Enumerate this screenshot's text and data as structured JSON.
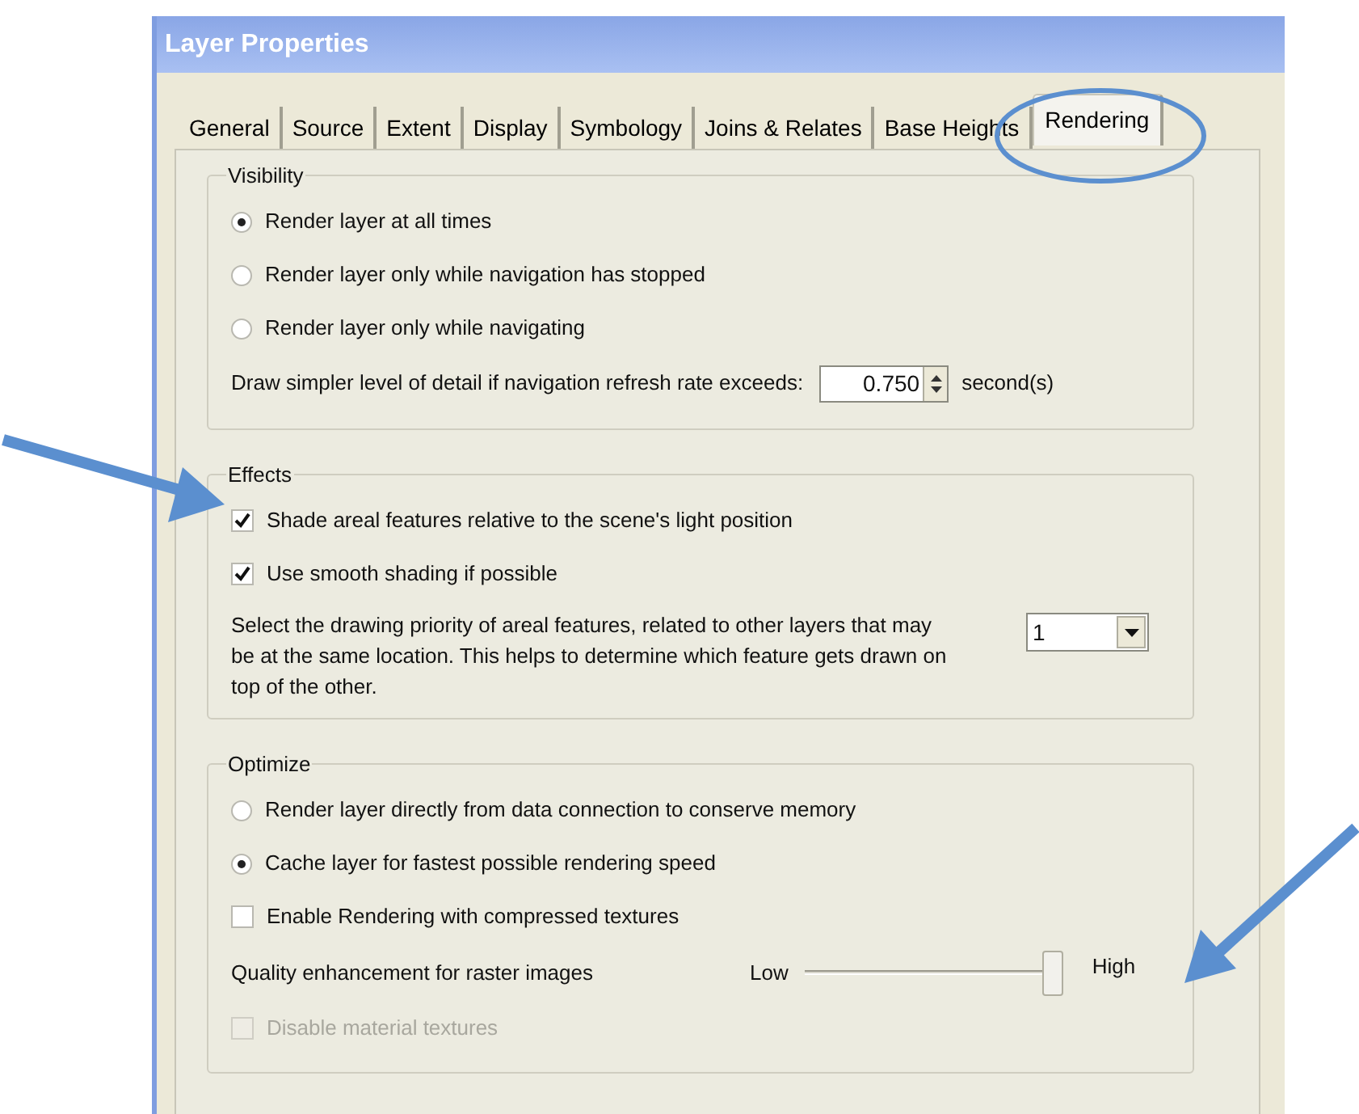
{
  "window": {
    "title": "Layer Properties"
  },
  "tabs": [
    {
      "label": "General",
      "selected": false
    },
    {
      "label": "Source",
      "selected": false
    },
    {
      "label": "Extent",
      "selected": false
    },
    {
      "label": "Display",
      "selected": false
    },
    {
      "label": "Symbology",
      "selected": false
    },
    {
      "label": "Joins & Relates",
      "selected": false
    },
    {
      "label": "Base Heights",
      "selected": false
    },
    {
      "label": "Rendering",
      "selected": true
    }
  ],
  "groups": [
    {
      "title": "Visibility",
      "items": [
        {
          "kind": "radio",
          "label": "Render layer at all times",
          "selected": true
        },
        {
          "kind": "radio",
          "label": "Render layer only while navigation has stopped",
          "selected": false
        },
        {
          "kind": "radio",
          "label": "Render layer only while navigating",
          "selected": false
        },
        {
          "kind": "spin",
          "label": "Draw simpler level of detail if navigation refresh rate exceeds:",
          "value": "0.750",
          "unit": "second(s)"
        }
      ]
    },
    {
      "title": "Effects",
      "items": [
        {
          "kind": "checkbox",
          "label": "Shade areal features relative to the scene's light position",
          "checked": true,
          "disabled": false
        },
        {
          "kind": "checkbox",
          "label": "Use smooth shading if possible",
          "checked": true,
          "disabled": false
        },
        {
          "kind": "select",
          "label": "Select the drawing priority of areal features, related to other layers that may be at the same location. This helps to determine which feature gets drawn on top of the other.",
          "value": "1"
        }
      ]
    },
    {
      "title": "Optimize",
      "items": [
        {
          "kind": "radio",
          "label": "Render layer directly from data connection to conserve memory",
          "selected": false
        },
        {
          "kind": "radio",
          "label": "Cache layer for fastest possible rendering speed",
          "selected": true
        },
        {
          "kind": "checkbox",
          "label": "Enable Rendering with compressed textures",
          "checked": false,
          "disabled": false
        },
        {
          "kind": "slider",
          "label": "Quality enhancement for raster images",
          "low": "Low",
          "high": "High",
          "level": 1
        },
        {
          "kind": "checkbox",
          "label": "Disable material textures",
          "checked": false,
          "disabled": true
        }
      ]
    }
  ]
}
